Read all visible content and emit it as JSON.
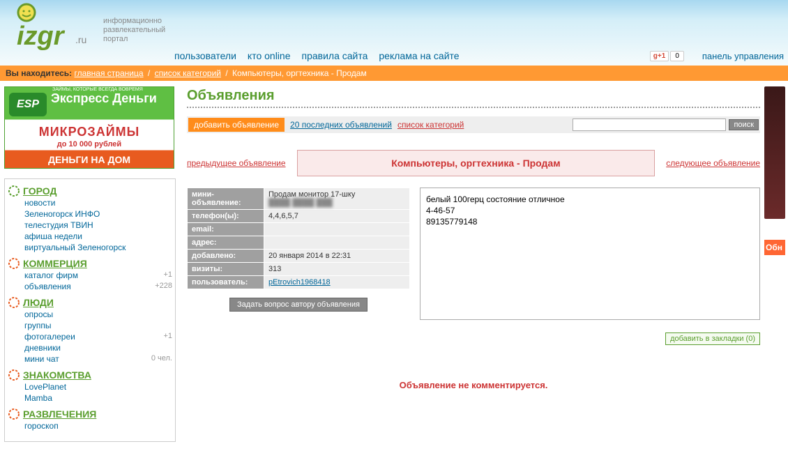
{
  "header": {
    "tagline": "информационно\nразвлекательный\nпортал",
    "nav": [
      "пользователи",
      "кто online",
      "правила сайта",
      "реклама на сайте"
    ],
    "gplus_label": "g+1",
    "gplus_count": "0",
    "panel_link": "панель управления"
  },
  "breadcrumb": {
    "label": "Вы находитесь:",
    "items": [
      {
        "text": "главная страница",
        "link": true
      },
      {
        "text": "список категорий",
        "link": true
      },
      {
        "text": "Компьютеры, оргтехника - Продам",
        "link": false
      }
    ]
  },
  "banner": {
    "esp": "ESP",
    "small": "ЗАЙМЫ, КОТОРЫЕ ВСЕГДА ВОВРЕМЯ",
    "express": "Экспресс Деньги",
    "micro": "МИКРОЗАЙМЫ",
    "upto": "до 10 000 рублей",
    "nadom": "ДЕНЬГИ НА ДОМ"
  },
  "sidebar": {
    "sections": [
      {
        "title": "ГОРОД",
        "items": [
          {
            "label": "новости"
          },
          {
            "label": "Зеленогорск ИНФО"
          },
          {
            "label": "телестудия ТВИН"
          },
          {
            "label": "афиша недели"
          },
          {
            "label": "виртуальный Зеленогорск"
          }
        ]
      },
      {
        "title": "КОММЕРЦИЯ",
        "items": [
          {
            "label": "каталог фирм",
            "count": "+1"
          },
          {
            "label": "объявления",
            "count": "+228"
          }
        ]
      },
      {
        "title": "ЛЮДИ",
        "items": [
          {
            "label": "опросы"
          },
          {
            "label": "группы"
          },
          {
            "label": "фотогалереи",
            "count": "+1"
          },
          {
            "label": "дневники"
          },
          {
            "label": "мини чат",
            "count": "0 чел."
          }
        ]
      },
      {
        "title": "ЗНАКОМСТВА",
        "items": [
          {
            "label": "LovePlanet"
          },
          {
            "label": "Mamba"
          }
        ]
      },
      {
        "title": "РАЗВЛЕЧЕНИЯ",
        "items": [
          {
            "label": "гороскоп"
          }
        ]
      }
    ]
  },
  "main": {
    "title": "Объявления",
    "add_btn": "добавить объявление",
    "last20": "20 последних объявлений",
    "cat_list": "список категорий",
    "search_btn": "поиск",
    "prev_link": "предыдущее объявление",
    "next_link": "следующее объявление",
    "category": "Компьютеры, оргтехника - Продам",
    "details": {
      "mini_label": "мини-объявление:",
      "mini_value": "Продам монитор 17-шку",
      "phone_label": "телефон(ы):",
      "phone_value": "4,4,6,5,7",
      "email_label": "email:",
      "email_value": "",
      "addr_label": "адрес:",
      "addr_value": "",
      "added_label": "добавлено:",
      "added_value": "20 января 2014 в 22:31",
      "visits_label": "визиты:",
      "visits_value": "313",
      "user_label": "пользователь:",
      "user_value": "pEtrovich1968418"
    },
    "ask_btn": "Задать вопрос автору объявления",
    "description": "белый 100герц состояние отличное\n4-46-57\n89135779148",
    "bookmark": "добавить в закладки (0)",
    "no_comments": "Объявление не комментируется."
  },
  "right_tab": "Обн"
}
